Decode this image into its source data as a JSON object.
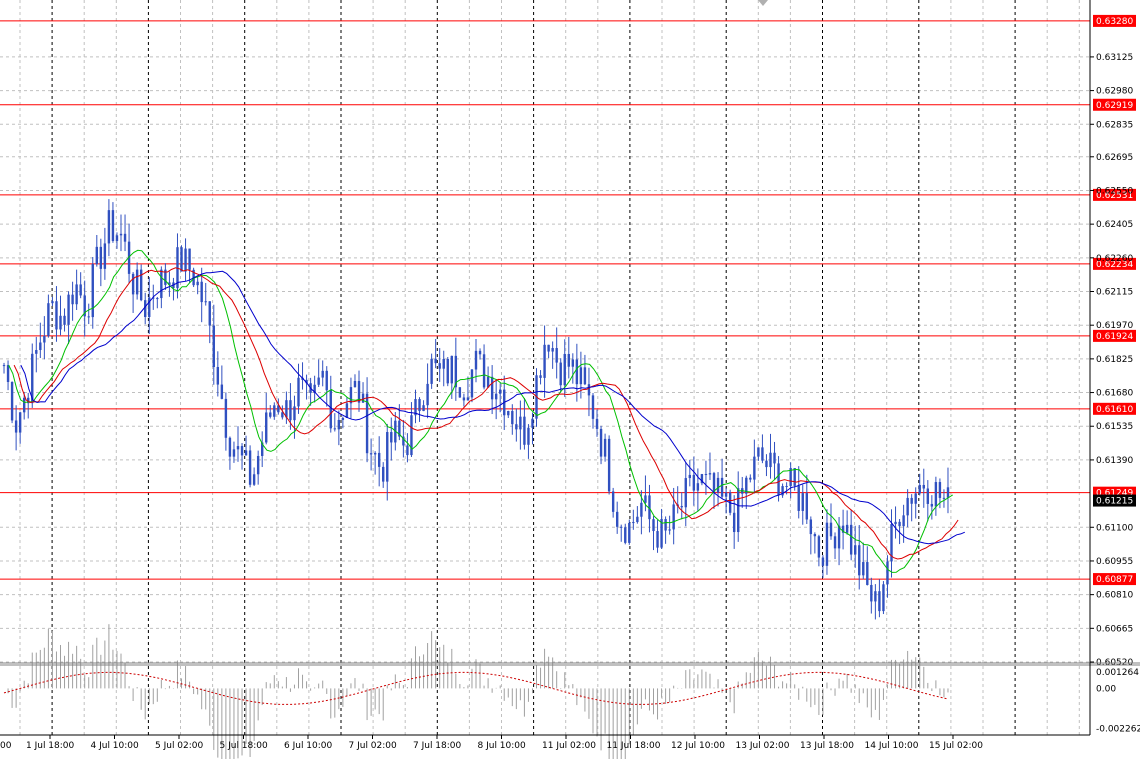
{
  "chart_data": [
    {
      "type": "candlestick",
      "price_axis": {
        "ylim": [
          0.6052,
          0.6337
        ],
        "tick_labels": [
          "0.63125",
          "0.62980",
          "0.62835",
          "0.62695",
          "0.62550",
          "0.62405",
          "0.62260",
          "0.62115",
          "0.61970",
          "0.61825",
          "0.61680",
          "0.61535",
          "0.61390",
          "0.61100",
          "0.60955",
          "0.60810",
          "0.60665",
          "0.60520"
        ]
      },
      "time_axis": {
        "tick_labels": [
          "1 Jul 18:00",
          "4 Jul 10:00",
          "5 Jul 02:00",
          "5 Jul 18:00",
          "6 Jul 10:00",
          "7 Jul 02:00",
          "7 Jul 18:00",
          "8 Jul 10:00",
          "11 Jul 02:00",
          "11 Jul 18:00",
          "12 Jul 10:00",
          "13 Jul 02:00",
          "13 Jul 18:00",
          "14 Jul 10:00",
          "15 Jul 02:00"
        ],
        "edge_label": "00"
      },
      "levels": [
        {
          "label": "0.63280",
          "value": 0.6328,
          "color": "#ff0000"
        },
        {
          "label": "0.62919",
          "value": 0.62919,
          "color": "#ff0000"
        },
        {
          "label": "0.62531",
          "value": 0.62531,
          "color": "#ff0000"
        },
        {
          "label": "0.62234",
          "value": 0.62234,
          "color": "#ff0000"
        },
        {
          "label": "0.61924",
          "value": 0.61924,
          "color": "#ff0000"
        },
        {
          "label": "0.61610",
          "value": 0.6161,
          "color": "#ff0000"
        },
        {
          "label": "0.61249",
          "value": 0.61249,
          "color": "#ff0000"
        },
        {
          "label": "0.60877",
          "value": 0.60877,
          "color": "#ff0000"
        }
      ],
      "current_price": {
        "label": "0.61215",
        "value": 0.61215,
        "color": "#000000"
      },
      "price_path": [
        0.618,
        0.6155,
        0.617,
        0.619,
        0.6205,
        0.62,
        0.6215,
        0.6205,
        0.6225,
        0.624,
        0.6235,
        0.6215,
        0.6205,
        0.6215,
        0.6218,
        0.6225,
        0.622,
        0.6205,
        0.618,
        0.615,
        0.614,
        0.613,
        0.615,
        0.6165,
        0.616,
        0.617,
        0.616,
        0.6175,
        0.6155,
        0.6165,
        0.617,
        0.6145,
        0.6135,
        0.615,
        0.6145,
        0.616,
        0.618,
        0.6175,
        0.6178,
        0.6172,
        0.618,
        0.6175,
        0.617,
        0.616,
        0.615,
        0.617,
        0.6195,
        0.618,
        0.618,
        0.617,
        0.616,
        0.614,
        0.6115,
        0.611,
        0.612,
        0.611,
        0.6105,
        0.6115,
        0.6125,
        0.613,
        0.6125,
        0.612,
        0.6115,
        0.613,
        0.614,
        0.6135,
        0.613,
        0.6125,
        0.612,
        0.61,
        0.6105,
        0.6115,
        0.61,
        0.6085,
        0.6075,
        0.61,
        0.612,
        0.6125,
        0.613,
        0.6125,
        0.612
      ],
      "indicator_lines": [
        {
          "color": "#00c000",
          "period": 5
        },
        {
          "color": "#dd0000",
          "period": 9
        },
        {
          "color": "#0000cc",
          "period": 14
        }
      ],
      "colors": {
        "candle": "#3050c0",
        "grid": "#c0c0c0",
        "period_separator": "#000000",
        "panel_divider": "#808080",
        "background": "#ffffff"
      }
    },
    {
      "type": "histogram",
      "indicator_axis": {
        "ylim": [
          -0.00262,
          0.00126
        ],
        "tick_labels": [
          "0.001264",
          "0.00",
          "-0.002262"
        ]
      },
      "signal_color": "#cc0000",
      "histogram_color": "#a0a0a0"
    }
  ]
}
